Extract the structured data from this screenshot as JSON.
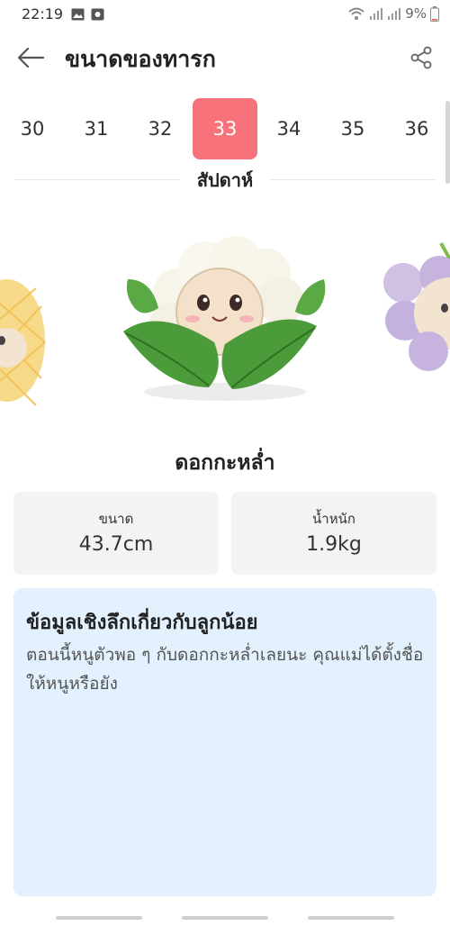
{
  "status_bar": {
    "time": "22:19",
    "battery": "9%"
  },
  "header": {
    "title": "ขนาดของทารก"
  },
  "weeks": {
    "items": [
      "30",
      "31",
      "32",
      "33",
      "34",
      "35",
      "36"
    ],
    "selected": "33",
    "unit": "สัปดาห์"
  },
  "fruit": {
    "name": "ดอกกะหล่ำ"
  },
  "stats": {
    "size_label": "ขนาด",
    "size_value": "43.7cm",
    "weight_label": "น้ำหนัก",
    "weight_value": "1.9kg"
  },
  "info": {
    "title": "ข้อมูลเชิงลึกเกี่ยวกับลูกน้อย",
    "body": "ตอนนี้หนูตัวพอ ๆ กับดอกกะหล่ำเลยนะ คุณแม่ได้ตั้งชื่อให้หนูหรือยัง"
  },
  "colors": {
    "accent": "#f7727a",
    "info_bg": "#e3f0fd",
    "card_bg": "#f2f3f5"
  },
  "icons": [
    "gallery-icon",
    "camera-icon",
    "wifi-icon",
    "signal-icon",
    "battery-icon",
    "back-arrow-icon",
    "share-icon"
  ]
}
